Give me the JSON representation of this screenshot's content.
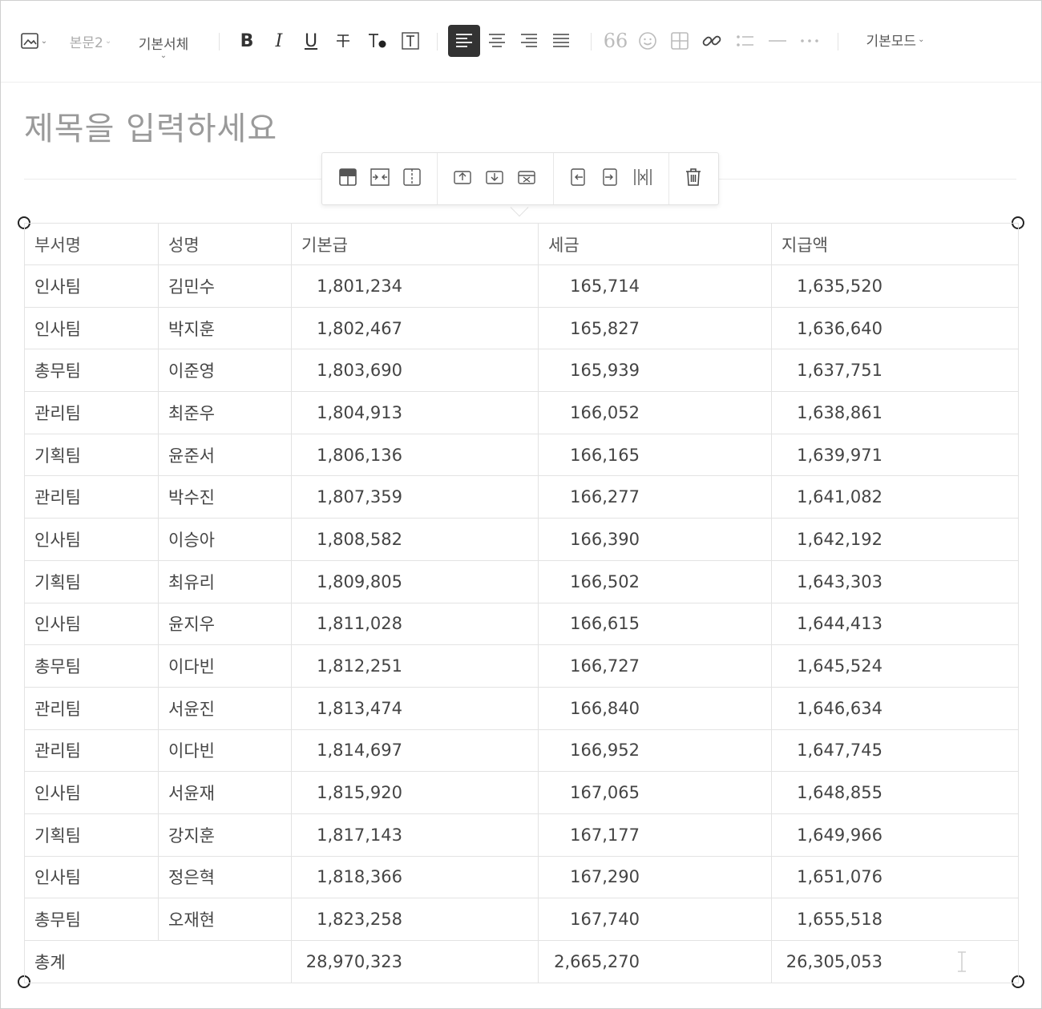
{
  "toolbar": {
    "paragraph_style": "본문2",
    "font_family": "기본서체",
    "mode": "기본모드"
  },
  "editor": {
    "title_placeholder": "제목을 입력하세요"
  },
  "table": {
    "columns": [
      "부서명",
      "성명",
      "기본급",
      "세금",
      "지급액"
    ],
    "rows": [
      [
        "인사팀",
        "김민수",
        "1,801,234",
        "165,714",
        "1,635,520"
      ],
      [
        "인사팀",
        "박지훈",
        "1,802,467",
        "165,827",
        "1,636,640"
      ],
      [
        "총무팀",
        "이준영",
        "1,803,690",
        "165,939",
        "1,637,751"
      ],
      [
        "관리팀",
        "최준우",
        "1,804,913",
        "166,052",
        "1,638,861"
      ],
      [
        "기획팀",
        "윤준서",
        "1,806,136",
        "166,165",
        "1,639,971"
      ],
      [
        "관리팀",
        "박수진",
        "1,807,359",
        "166,277",
        "1,641,082"
      ],
      [
        "인사팀",
        "이승아",
        "1,808,582",
        "166,390",
        "1,642,192"
      ],
      [
        "기획팀",
        "최유리",
        "1,809,805",
        "166,502",
        "1,643,303"
      ],
      [
        "인사팀",
        "윤지우",
        "1,811,028",
        "166,615",
        "1,644,413"
      ],
      [
        "총무팀",
        "이다빈",
        "1,812,251",
        "166,727",
        "1,645,524"
      ],
      [
        "관리팀",
        "서윤진",
        "1,813,474",
        "166,840",
        "1,646,634"
      ],
      [
        "관리팀",
        "이다빈",
        "1,814,697",
        "166,952",
        "1,647,745"
      ],
      [
        "인사팀",
        "서윤재",
        "1,815,920",
        "167,065",
        "1,648,855"
      ],
      [
        "기획팀",
        "강지훈",
        "1,817,143",
        "167,177",
        "1,649,966"
      ],
      [
        "인사팀",
        "정은혁",
        "1,818,366",
        "167,290",
        "1,651,076"
      ],
      [
        "총무팀",
        "오재현",
        "1,823,258",
        "167,740",
        "1,655,518"
      ]
    ],
    "total": {
      "label": "총계",
      "base_pay": "28,970,323",
      "tax": "2,665,270",
      "net_pay": "26,305,053"
    }
  }
}
